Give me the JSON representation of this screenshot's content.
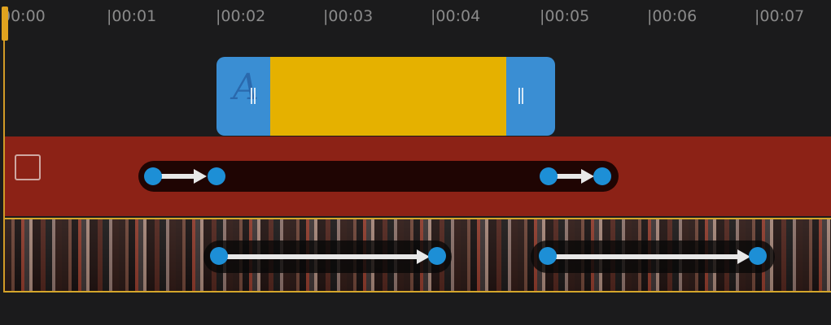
{
  "ruler": {
    "ticks": [
      {
        "label": "00:00"
      },
      {
        "label": "|00:01"
      },
      {
        "label": "|00:02"
      },
      {
        "label": "|00:03"
      },
      {
        "label": "|00:04"
      },
      {
        "label": "|00:05"
      },
      {
        "label": "|00:06"
      },
      {
        "label": "|00:07"
      }
    ]
  },
  "text_clip": {
    "letter": "A",
    "trim_handle_left": "||",
    "trim_handle_right": "||"
  },
  "colors": {
    "text_clip_blue": "#3a8ed3",
    "text_clip_yellow": "#e5b100",
    "red_track": "#8c2216",
    "video_track_border": "#d4a62b",
    "keyframe_dot": "#1d8fd6",
    "playhead": "#e0a31f",
    "background": "#1b1b1c"
  },
  "icons": {
    "track_checkbox": "checkbox-icon",
    "keyframe": "keyframe-dot-icon",
    "transition_arrow": "arrow-right-icon"
  }
}
